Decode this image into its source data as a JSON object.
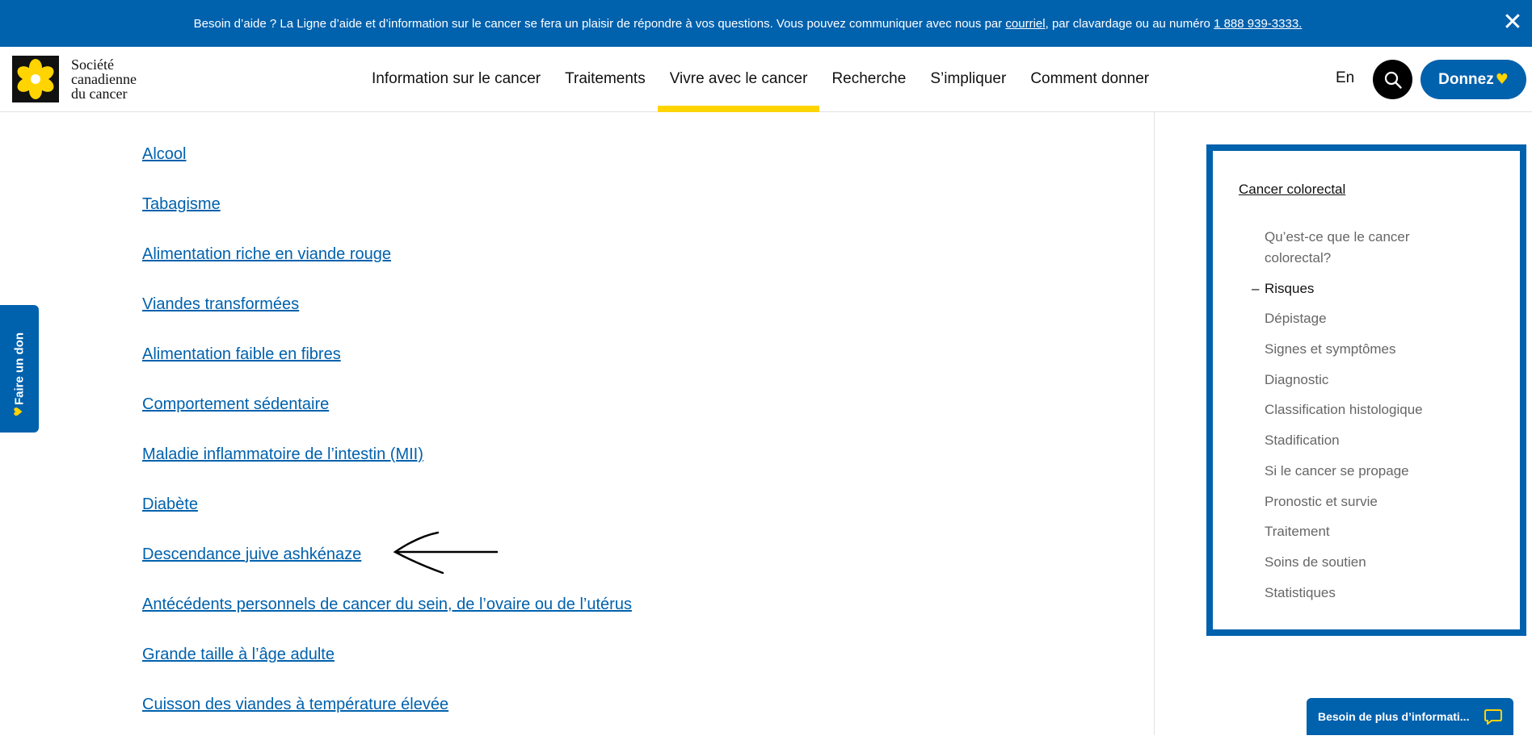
{
  "topbar": {
    "message_prefix": "Besoin d’aide ? La Ligne d’aide et d’information sur le cancer se fera un plaisir de répondre à vos questions. Vous pouvez communiquer avec nous par",
    "email_link": "courriel",
    "message_middle": ", par clavardage ou au numéro",
    "phone_link": "1 888 939-3333.",
    "close_label": "✕"
  },
  "header": {
    "logo_name_line1": "Société",
    "logo_name_line2": "canadienne",
    "logo_name_line3": "du cancer",
    "nav": [
      {
        "label": "Information sur le cancer"
      },
      {
        "label": "Traitements"
      },
      {
        "label": "Vivre avec le cancer"
      },
      {
        "label": "Recherche"
      },
      {
        "label": "S’impliquer"
      },
      {
        "label": "Comment donner"
      }
    ],
    "active_nav": "Vivre avec le cancer",
    "lang": "En",
    "donate_label": "Donnez",
    "donate_heart": "♥"
  },
  "side_tab": {
    "label": "Faire un don",
    "heart": "♥"
  },
  "risk_links": [
    "Alcool",
    "Tabagisme",
    "Alimentation riche en viande rouge",
    "Viandes transformées",
    "Alimentation faible en fibres",
    "Comportement sédentaire",
    "Maladie inflammatoire de l’intestin (MII)",
    "Diabète",
    "Descendance juive ashkénaze",
    "Antécédents personnels de cancer du sein, de l’ovaire ou de l’utérus",
    "Grande taille à l’âge adulte",
    "Cuisson des viandes à température élevée"
  ],
  "sidebar": {
    "parent": "Cancer colorectal",
    "items": [
      {
        "label": "Qu’est-ce que le cancer colorectal?",
        "current": false
      },
      {
        "label": "Risques",
        "current": true
      },
      {
        "label": "Dépistage",
        "current": false
      },
      {
        "label": "Signes et symptômes",
        "current": false
      },
      {
        "label": "Diagnostic",
        "current": false
      },
      {
        "label": "Classification histologique",
        "current": false
      },
      {
        "label": "Stadification",
        "current": false
      },
      {
        "label": "Si le cancer se propage",
        "current": false
      },
      {
        "label": "Pronostic et survie",
        "current": false
      },
      {
        "label": "Traitement",
        "current": false
      },
      {
        "label": "Soins de soutien",
        "current": false
      },
      {
        "label": "Statistiques",
        "current": false
      }
    ]
  },
  "chat": {
    "label": "Besoin de plus d’informati..."
  },
  "colors": {
    "brand_blue": "#0061ad",
    "accent_yellow": "#ffd400"
  }
}
